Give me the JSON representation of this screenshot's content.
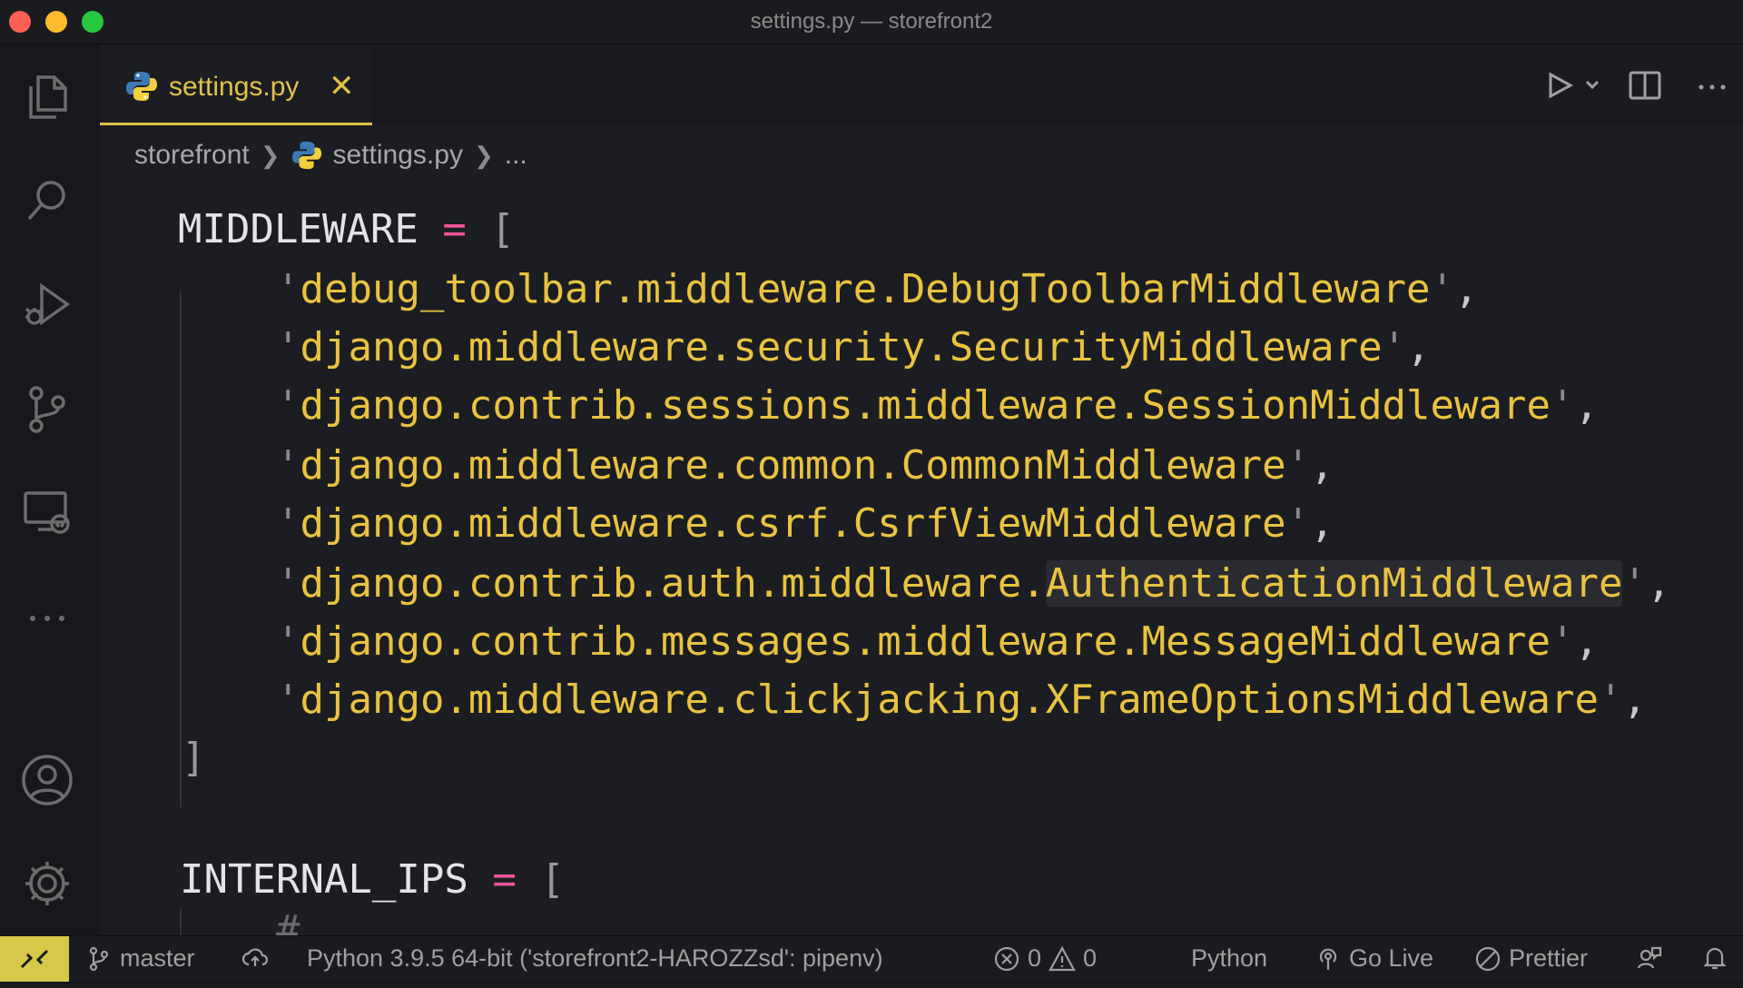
{
  "window": {
    "title": "settings.py — storefront2"
  },
  "tab": {
    "label": "settings.py",
    "close": "✕"
  },
  "breadcrumb": {
    "folder": "storefront",
    "file": "settings.py",
    "more": "..."
  },
  "code": {
    "middleware": {
      "name": "MIDDLEWARE",
      "op": "=",
      "open": "[",
      "close": "]",
      "items": [
        "debug_toolbar.middleware.DebugToolbarMiddleware",
        "django.middleware.security.SecurityMiddleware",
        "django.contrib.sessions.middleware.SessionMiddleware",
        "django.middleware.common.CommonMiddleware",
        "django.middleware.csrf.CsrfViewMiddleware",
        "django.contrib.auth.middleware.",
        "django.contrib.messages.middleware.MessageMiddleware",
        "django.middleware.clickjacking.XFrameOptionsMiddleware"
      ],
      "highlighted_word": "AuthenticationMiddleware"
    },
    "internal_ips": {
      "name": "INTERNAL_IPS",
      "op": "=",
      "open": "[",
      "peek": "#"
    }
  },
  "statusbar": {
    "branch": "master",
    "interpreter": "Python 3.9.5 64-bit ('storefront2-HAROZZsd': pipenv)",
    "errors": "0",
    "warnings": "0",
    "language": "Python",
    "golive": "Go Live",
    "prettier": "Prettier"
  },
  "colors": {
    "accent": "#e2c14a",
    "string": "#e9c340",
    "operator": "#f0569b",
    "remote": "#d6c94a"
  }
}
